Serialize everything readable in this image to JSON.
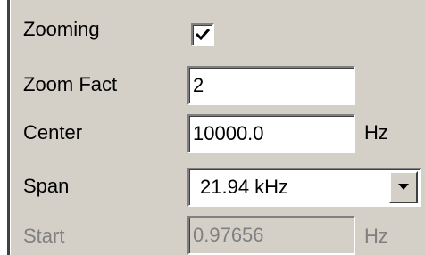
{
  "zooming": {
    "label": "Zooming",
    "checked": true
  },
  "zoom_fact": {
    "label": "Zoom Fact",
    "value": "2"
  },
  "center": {
    "label": "Center",
    "value": "10000.0",
    "unit": "Hz"
  },
  "span": {
    "label": "Span",
    "value": "21.94 kHz"
  },
  "start": {
    "label": "Start",
    "value": "0.97656",
    "unit": "Hz",
    "enabled": false
  },
  "icons": {
    "checkbox": "checkmark-icon",
    "dropdown": "chevron-down-icon"
  }
}
